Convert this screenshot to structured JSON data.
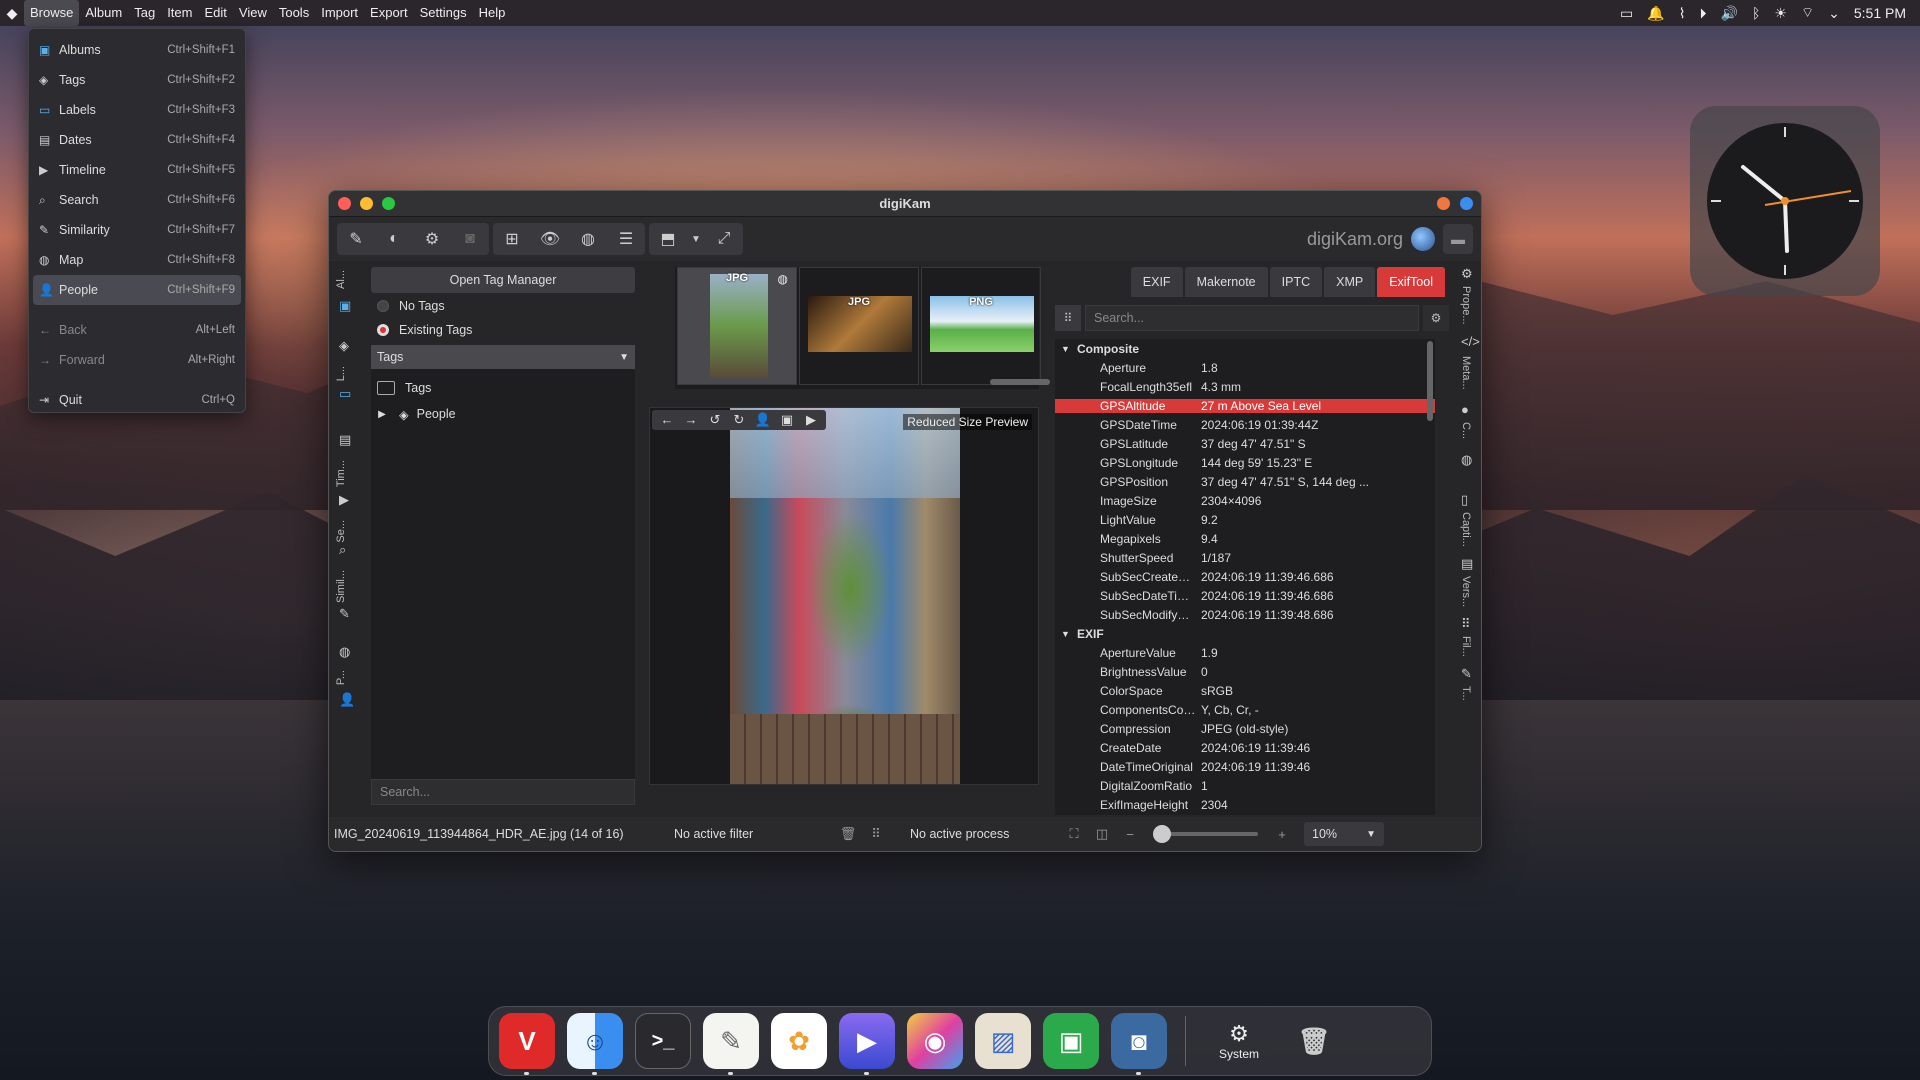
{
  "menubar": {
    "logo": "app-logo",
    "items": [
      "Browse",
      "Album",
      "Tag",
      "Item",
      "Edit",
      "View",
      "Tools",
      "Import",
      "Export",
      "Settings",
      "Help"
    ],
    "active": "Browse",
    "clock": "5:51 PM"
  },
  "browse_menu": {
    "items": [
      {
        "label": "Albums",
        "shortcut": "Ctrl+Shift+F1",
        "icon": "album-icon"
      },
      {
        "label": "Tags",
        "shortcut": "Ctrl+Shift+F2",
        "icon": "tag-icon"
      },
      {
        "label": "Labels",
        "shortcut": "Ctrl+Shift+F3",
        "icon": "labels-icon"
      },
      {
        "label": "Dates",
        "shortcut": "Ctrl+Shift+F4",
        "icon": "dates-icon"
      },
      {
        "label": "Timeline",
        "shortcut": "Ctrl+Shift+F5",
        "icon": "timeline-icon"
      },
      {
        "label": "Search",
        "shortcut": "Ctrl+Shift+F6",
        "icon": "search-icon"
      },
      {
        "label": "Similarity",
        "shortcut": "Ctrl+Shift+F7",
        "icon": "similarity-icon"
      },
      {
        "label": "Map",
        "shortcut": "Ctrl+Shift+F8",
        "icon": "map-icon"
      },
      {
        "label": "People",
        "shortcut": "Ctrl+Shift+F9",
        "icon": "people-icon"
      }
    ],
    "nav": [
      {
        "label": "Back",
        "shortcut": "Alt+Left",
        "icon": "back-arrow-icon"
      },
      {
        "label": "Forward",
        "shortcut": "Alt+Right",
        "icon": "forward-arrow-icon"
      }
    ],
    "quit": {
      "label": "Quit",
      "shortcut": "Ctrl+Q",
      "icon": "quit-icon"
    }
  },
  "window": {
    "title": "digiKam",
    "brand": "digiKam.org"
  },
  "left_sidebar": {
    "tabs": [
      "Al...",
      "L...",
      "Tim...",
      "Se...",
      "Simil...",
      "P..."
    ]
  },
  "tag_panel": {
    "open_button": "Open Tag Manager",
    "radio_no_tags": "No Tags",
    "radio_existing": "Existing Tags",
    "filter_select": "Tags",
    "tree": [
      {
        "label": "Tags"
      },
      {
        "label": "People"
      }
    ],
    "search_placeholder": "Search..."
  },
  "thumbnails": [
    {
      "badge": "JPG"
    },
    {
      "badge": "JPG"
    },
    {
      "badge": "PNG"
    }
  ],
  "preview": {
    "label": "Reduced Size Preview"
  },
  "metadata": {
    "tabs": [
      "EXIF",
      "Makernote",
      "IPTC",
      "XMP",
      "ExifTool"
    ],
    "active_tab": "ExifTool",
    "search_placeholder": "Search...",
    "groups": [
      {
        "name": "Composite",
        "rows": [
          {
            "k": "Aperture",
            "v": "1.8"
          },
          {
            "k": "FocalLength35efl",
            "v": "4.3 mm"
          },
          {
            "k": "GPSAltitude",
            "v": "27 m Above Sea Level",
            "hl": true
          },
          {
            "k": "GPSDateTime",
            "v": "2024:06:19 01:39:44Z"
          },
          {
            "k": "GPSLatitude",
            "v": "37 deg 47' 47.51\" S"
          },
          {
            "k": "GPSLongitude",
            "v": "144 deg 59' 15.23\" E"
          },
          {
            "k": "GPSPosition",
            "v": "37 deg 47' 47.51\" S, 144 deg ..."
          },
          {
            "k": "ImageSize",
            "v": "2304×4096"
          },
          {
            "k": "LightValue",
            "v": "9.2"
          },
          {
            "k": "Megapixels",
            "v": "9.4"
          },
          {
            "k": "ShutterSpeed",
            "v": "1/187"
          },
          {
            "k": "SubSecCreateDate",
            "v": "2024:06:19 11:39:46.686"
          },
          {
            "k": "SubSecDateTimeOrigi...",
            "v": "2024:06:19 11:39:46.686"
          },
          {
            "k": "SubSecModifyDate",
            "v": "2024:06:19 11:39:48.686"
          }
        ]
      },
      {
        "name": "EXIF",
        "rows": [
          {
            "k": "ApertureValue",
            "v": "1.9"
          },
          {
            "k": "BrightnessValue",
            "v": "0"
          },
          {
            "k": "ColorSpace",
            "v": "sRGB"
          },
          {
            "k": "ComponentsConfigur...",
            "v": "Y, Cb, Cr, -"
          },
          {
            "k": "Compression",
            "v": "JPEG (old-style)"
          },
          {
            "k": "CreateDate",
            "v": "2024:06:19 11:39:46"
          },
          {
            "k": "DateTimeOriginal",
            "v": "2024:06:19 11:39:46"
          },
          {
            "k": "DigitalZoomRatio",
            "v": "1"
          },
          {
            "k": "ExifImageHeight",
            "v": "2304"
          }
        ]
      }
    ]
  },
  "right_sidebar": {
    "tabs": [
      "Prope...",
      "Meta...",
      "C...",
      "Capti...",
      "Vers...",
      "Fil...",
      "T..."
    ]
  },
  "status": {
    "file": "IMG_20240619_113944864_HDR_AE.jpg (14 of 16)",
    "filter": "No active filter",
    "process": "No active process",
    "zoom": "10%",
    "zoom_level": 0.05
  },
  "dock": {
    "apps": [
      "vivaldi",
      "finder",
      "terminal",
      "text-editor",
      "photos",
      "media-player",
      "color-picker",
      "preview",
      "cassette-app",
      "digikam"
    ],
    "system_label": "System"
  },
  "colors": {
    "accent": "#d83a3a",
    "selection": "#4a4a52"
  }
}
